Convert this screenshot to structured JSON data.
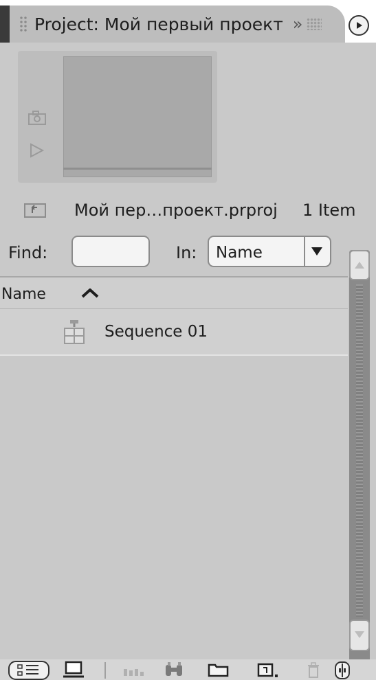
{
  "panel": {
    "tab_title": "Project: Мой первый проект",
    "tab_overflow": "»"
  },
  "project": {
    "file_name": "Мой пер…проект.prproj",
    "item_count": "1 Item"
  },
  "find": {
    "label": "Find:",
    "value": "",
    "in_label": "In:",
    "in_value": "Name"
  },
  "list": {
    "column_header": "Name",
    "sort_direction": "ascending",
    "items": [
      {
        "name": "Sequence 01",
        "icon": "sequence-icon"
      }
    ]
  },
  "toolbar": {
    "buttons": [
      "list-view-icon",
      "icon-view-icon",
      "automate-to-sequence-icon",
      "find-binoculars-icon",
      "new-bin-folder-icon",
      "new-item-icon",
      "delete-trash-icon",
      "zoom-toggle-icon"
    ]
  }
}
